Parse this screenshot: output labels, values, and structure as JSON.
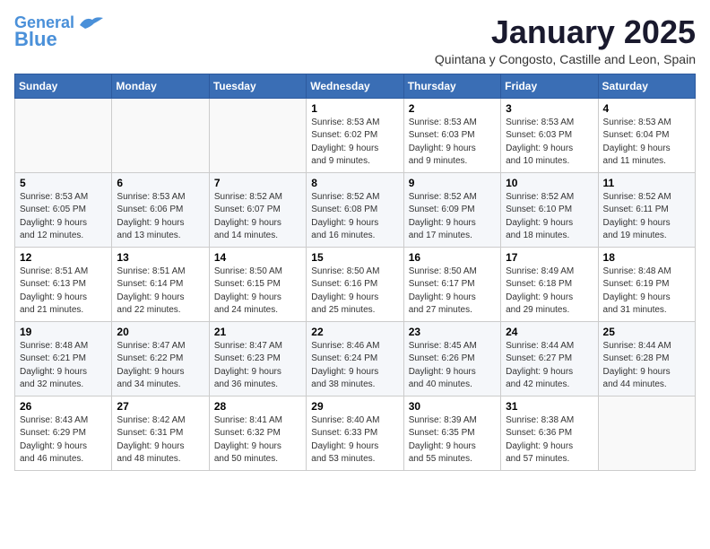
{
  "logo": {
    "line1": "General",
    "line2": "Blue"
  },
  "title": "January 2025",
  "subtitle": "Quintana y Congosto, Castille and Leon, Spain",
  "weekdays": [
    "Sunday",
    "Monday",
    "Tuesday",
    "Wednesday",
    "Thursday",
    "Friday",
    "Saturday"
  ],
  "weeks": [
    [
      {
        "day": "",
        "info": ""
      },
      {
        "day": "",
        "info": ""
      },
      {
        "day": "",
        "info": ""
      },
      {
        "day": "1",
        "info": "Sunrise: 8:53 AM\nSunset: 6:02 PM\nDaylight: 9 hours\nand 9 minutes."
      },
      {
        "day": "2",
        "info": "Sunrise: 8:53 AM\nSunset: 6:03 PM\nDaylight: 9 hours\nand 9 minutes."
      },
      {
        "day": "3",
        "info": "Sunrise: 8:53 AM\nSunset: 6:03 PM\nDaylight: 9 hours\nand 10 minutes."
      },
      {
        "day": "4",
        "info": "Sunrise: 8:53 AM\nSunset: 6:04 PM\nDaylight: 9 hours\nand 11 minutes."
      }
    ],
    [
      {
        "day": "5",
        "info": "Sunrise: 8:53 AM\nSunset: 6:05 PM\nDaylight: 9 hours\nand 12 minutes."
      },
      {
        "day": "6",
        "info": "Sunrise: 8:53 AM\nSunset: 6:06 PM\nDaylight: 9 hours\nand 13 minutes."
      },
      {
        "day": "7",
        "info": "Sunrise: 8:52 AM\nSunset: 6:07 PM\nDaylight: 9 hours\nand 14 minutes."
      },
      {
        "day": "8",
        "info": "Sunrise: 8:52 AM\nSunset: 6:08 PM\nDaylight: 9 hours\nand 16 minutes."
      },
      {
        "day": "9",
        "info": "Sunrise: 8:52 AM\nSunset: 6:09 PM\nDaylight: 9 hours\nand 17 minutes."
      },
      {
        "day": "10",
        "info": "Sunrise: 8:52 AM\nSunset: 6:10 PM\nDaylight: 9 hours\nand 18 minutes."
      },
      {
        "day": "11",
        "info": "Sunrise: 8:52 AM\nSunset: 6:11 PM\nDaylight: 9 hours\nand 19 minutes."
      }
    ],
    [
      {
        "day": "12",
        "info": "Sunrise: 8:51 AM\nSunset: 6:13 PM\nDaylight: 9 hours\nand 21 minutes."
      },
      {
        "day": "13",
        "info": "Sunrise: 8:51 AM\nSunset: 6:14 PM\nDaylight: 9 hours\nand 22 minutes."
      },
      {
        "day": "14",
        "info": "Sunrise: 8:50 AM\nSunset: 6:15 PM\nDaylight: 9 hours\nand 24 minutes."
      },
      {
        "day": "15",
        "info": "Sunrise: 8:50 AM\nSunset: 6:16 PM\nDaylight: 9 hours\nand 25 minutes."
      },
      {
        "day": "16",
        "info": "Sunrise: 8:50 AM\nSunset: 6:17 PM\nDaylight: 9 hours\nand 27 minutes."
      },
      {
        "day": "17",
        "info": "Sunrise: 8:49 AM\nSunset: 6:18 PM\nDaylight: 9 hours\nand 29 minutes."
      },
      {
        "day": "18",
        "info": "Sunrise: 8:48 AM\nSunset: 6:19 PM\nDaylight: 9 hours\nand 31 minutes."
      }
    ],
    [
      {
        "day": "19",
        "info": "Sunrise: 8:48 AM\nSunset: 6:21 PM\nDaylight: 9 hours\nand 32 minutes."
      },
      {
        "day": "20",
        "info": "Sunrise: 8:47 AM\nSunset: 6:22 PM\nDaylight: 9 hours\nand 34 minutes."
      },
      {
        "day": "21",
        "info": "Sunrise: 8:47 AM\nSunset: 6:23 PM\nDaylight: 9 hours\nand 36 minutes."
      },
      {
        "day": "22",
        "info": "Sunrise: 8:46 AM\nSunset: 6:24 PM\nDaylight: 9 hours\nand 38 minutes."
      },
      {
        "day": "23",
        "info": "Sunrise: 8:45 AM\nSunset: 6:26 PM\nDaylight: 9 hours\nand 40 minutes."
      },
      {
        "day": "24",
        "info": "Sunrise: 8:44 AM\nSunset: 6:27 PM\nDaylight: 9 hours\nand 42 minutes."
      },
      {
        "day": "25",
        "info": "Sunrise: 8:44 AM\nSunset: 6:28 PM\nDaylight: 9 hours\nand 44 minutes."
      }
    ],
    [
      {
        "day": "26",
        "info": "Sunrise: 8:43 AM\nSunset: 6:29 PM\nDaylight: 9 hours\nand 46 minutes."
      },
      {
        "day": "27",
        "info": "Sunrise: 8:42 AM\nSunset: 6:31 PM\nDaylight: 9 hours\nand 48 minutes."
      },
      {
        "day": "28",
        "info": "Sunrise: 8:41 AM\nSunset: 6:32 PM\nDaylight: 9 hours\nand 50 minutes."
      },
      {
        "day": "29",
        "info": "Sunrise: 8:40 AM\nSunset: 6:33 PM\nDaylight: 9 hours\nand 53 minutes."
      },
      {
        "day": "30",
        "info": "Sunrise: 8:39 AM\nSunset: 6:35 PM\nDaylight: 9 hours\nand 55 minutes."
      },
      {
        "day": "31",
        "info": "Sunrise: 8:38 AM\nSunset: 6:36 PM\nDaylight: 9 hours\nand 57 minutes."
      },
      {
        "day": "",
        "info": ""
      }
    ]
  ]
}
